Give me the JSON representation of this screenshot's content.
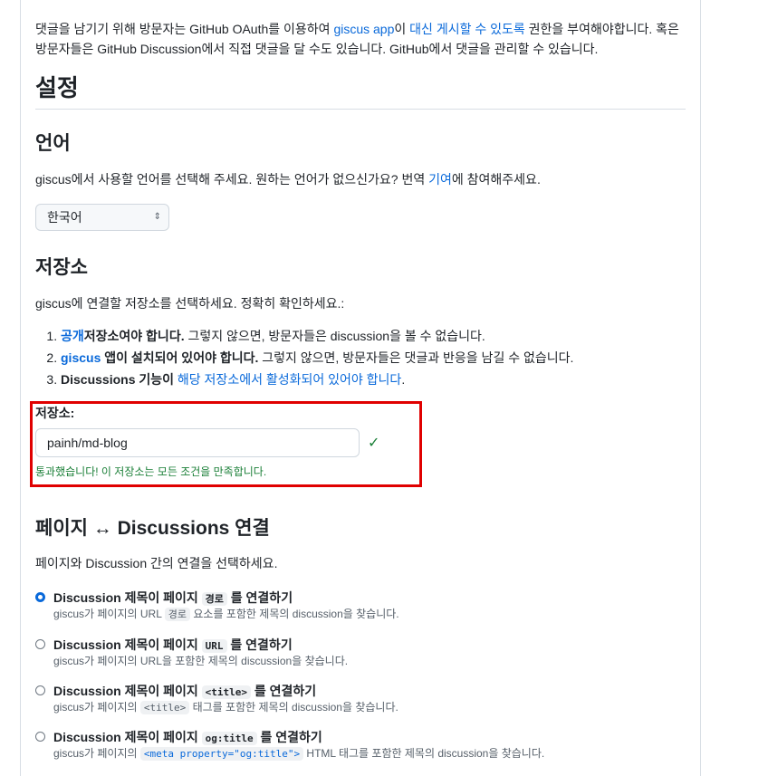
{
  "intro": {
    "t1": "댓글을 남기기 위해 방문자는 GitHub OAuth를 이용하여 ",
    "l1": "giscus app",
    "t2": "이 ",
    "l2": "대신 게시할 수 있도록",
    "t3": " 권한을 부여해야합니다. 혹은 방문자들은 GitHub Discussion에서 직접 댓글을 달 수도 있습니다. GitHub에서 댓글을 관리할 수 있습니다."
  },
  "settings": {
    "title": "설정"
  },
  "language": {
    "heading": "언어",
    "desc_start": "giscus에서 사용할 언어를 선택해 주세요. 원하는 언어가 없으신가요? 번역 ",
    "desc_link": "기여",
    "desc_end": "에 참여해주세요.",
    "selected": "한국어"
  },
  "repository": {
    "heading": "저장소",
    "desc": "giscus에 연결할 저장소를 선택하세요. 정확히 확인하세요.:",
    "req1_link": "공개",
    "req1_bold": "저장소여야 합니다.",
    "req1_rest": " 그렇지 않으면, 방문자들은 discussion을 볼 수 없습니다.",
    "req2_link": "giscus",
    "req2_bold": " 앱이 설치되어 있어야 합니다.",
    "req2_rest": " 그렇지 않으면, 방문자들은 댓글과 반응을 남길 수 없습니다.",
    "req3_bold": "Discussions 기능이",
    "req3_link": " 해당 저장소에서 활성화되어 있어야 합니다",
    "req3_rest": ".",
    "input_label": "저장소:",
    "input_value": "painh/md-blog",
    "success": "통과했습니다! 이 저장소는 모든 조건을 만족합니다."
  },
  "mapping": {
    "heading": "페이지 ↔ Discussions 연결",
    "desc": "페이지와 Discussion 간의 연결을 선택하세요.",
    "options": [
      {
        "title_start": "Discussion 제목이 페이지 ",
        "code": "경로",
        "title_end": " 를 연결하기",
        "desc_start": "giscus가 페이지의 URL ",
        "desc_code": "경로",
        "desc_end": " 요소를 포함한 제목의 discussion을 찾습니다.",
        "checked": true
      },
      {
        "title_start": "Discussion 제목이 페이지 ",
        "code": "URL",
        "title_end": " 를 연결하기",
        "desc": "giscus가 페이지의 URL을 포함한 제목의 discussion을 찾습니다.",
        "checked": false
      },
      {
        "title_start": "Discussion 제목이 페이지 ",
        "code": "<title>",
        "title_end": " 를 연결하기",
        "desc_start": "giscus가 페이지의 ",
        "desc_code": "<title>",
        "desc_end": " 태그를 포함한 제목의 discussion을 찾습니다.",
        "checked": false
      },
      {
        "title_start": "Discussion 제목이 페이지 ",
        "code": "og:title",
        "title_end": " 를 연결하기",
        "desc_start": "giscus가 페이지의 ",
        "desc_code": "<meta property=\"og:title\">",
        "desc_end": " HTML 태그를 포함한 제목의 discussion을 찾습니다.",
        "checked": false
      }
    ]
  },
  "colors": {
    "link": "#0969da",
    "success": "#1a7f37",
    "highlight": "#e00000"
  }
}
